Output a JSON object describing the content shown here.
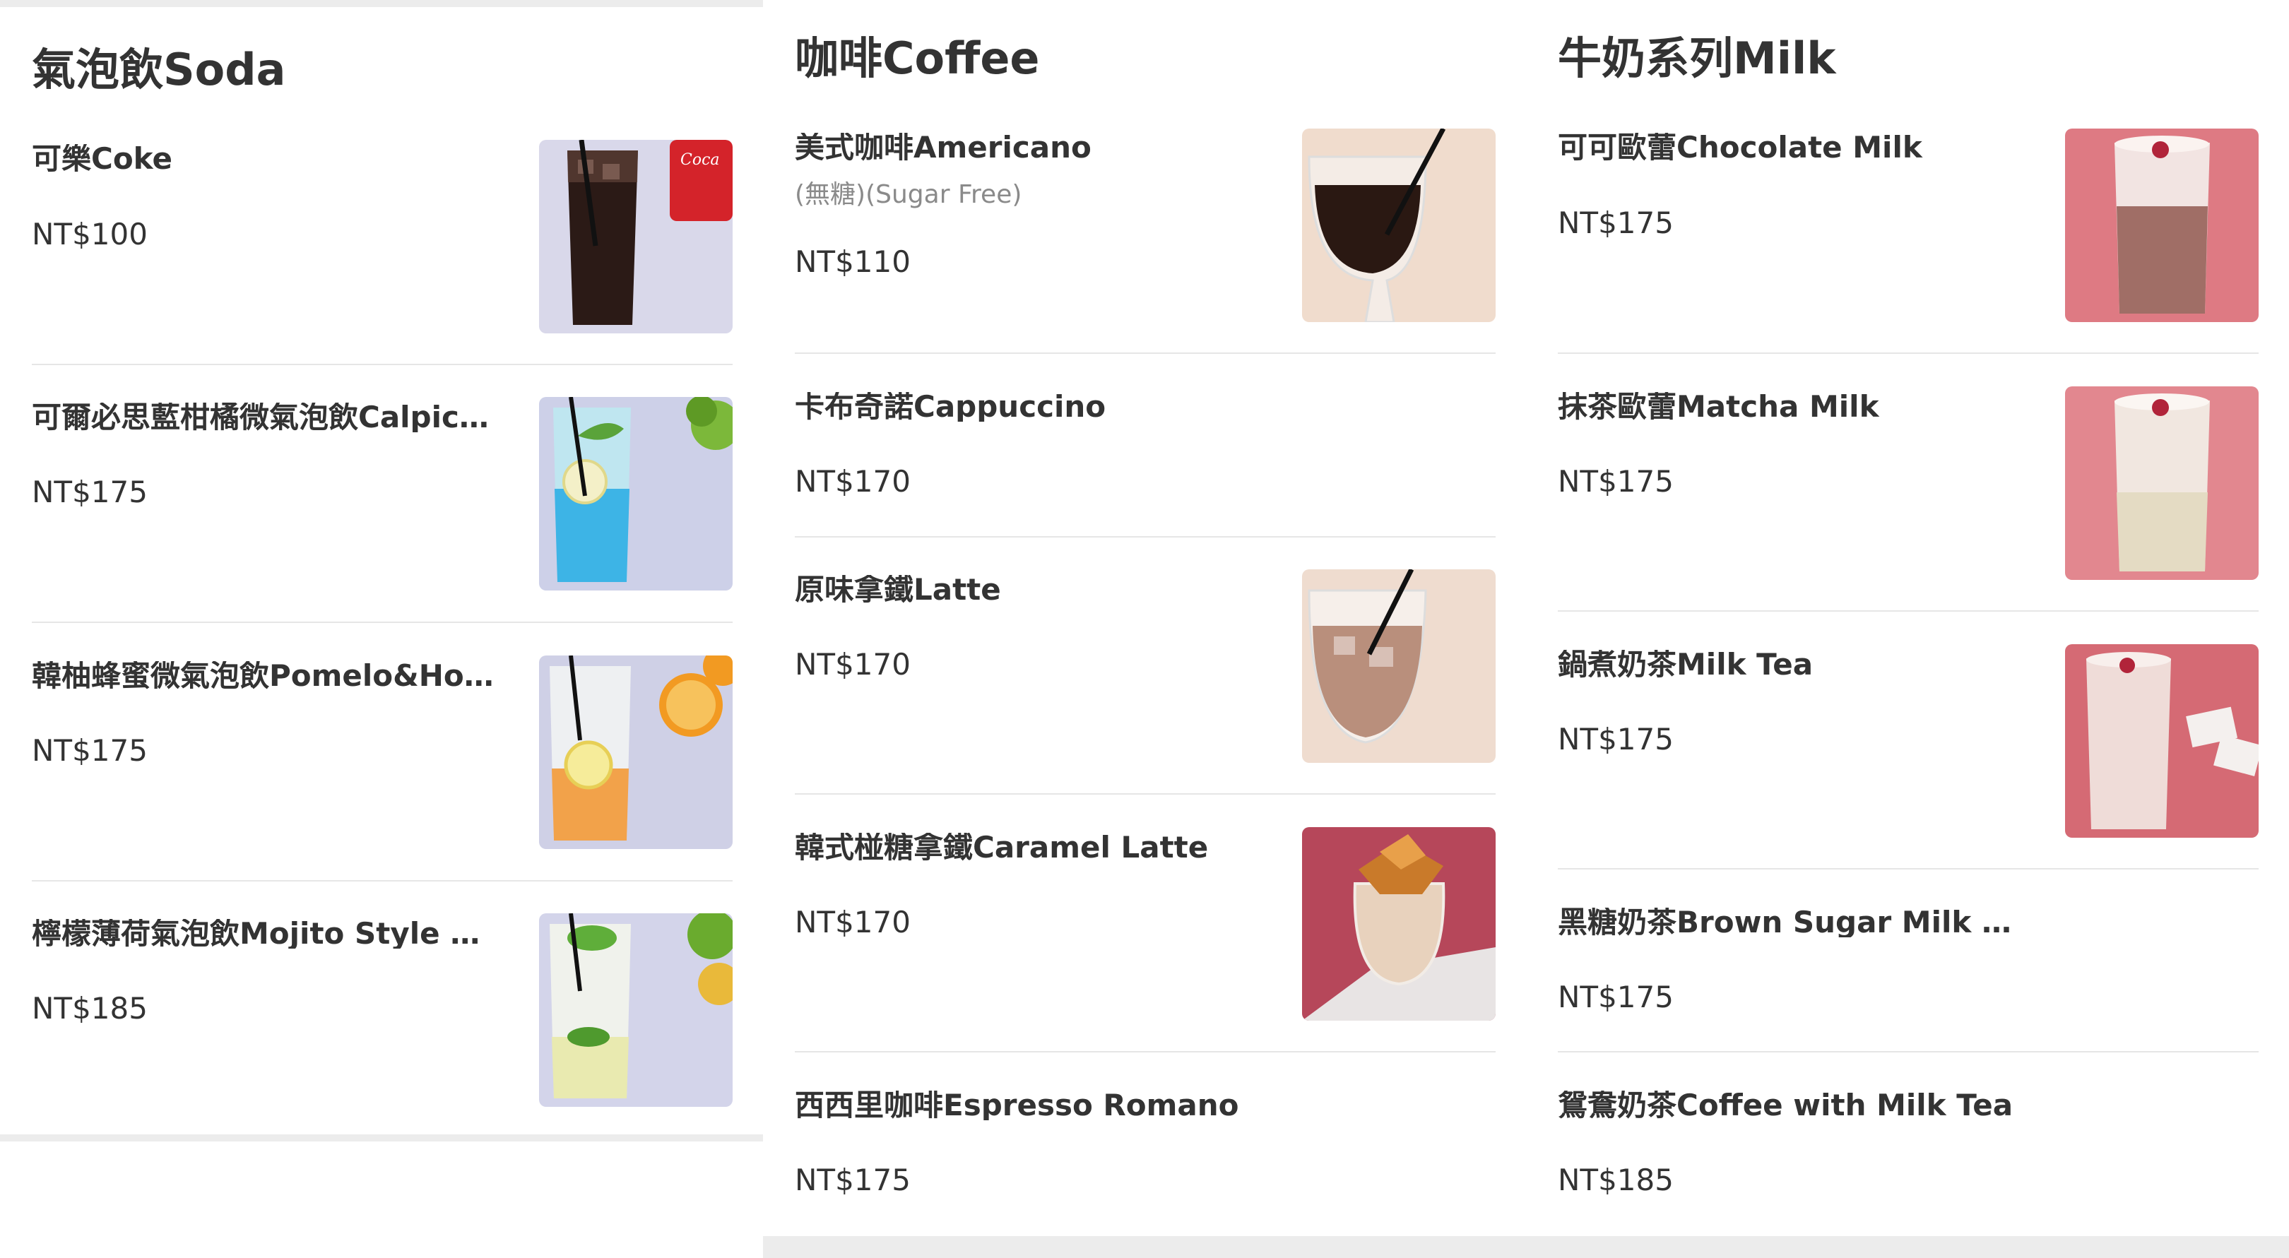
{
  "sections": {
    "soda": {
      "title": "氣泡飲Soda",
      "items": [
        {
          "name": "可樂Coke",
          "price": "NT$100",
          "image": "coke-glass-photo"
        },
        {
          "name": "可爾必思藍柑橘微氣泡飲Calpico...",
          "price": "NT$175",
          "image": "blue-calpico-soda-photo"
        },
        {
          "name": "韓柚蜂蜜微氣泡飲Pomelo&Hone...",
          "price": "NT$175",
          "image": "pomelo-honey-soda-photo"
        },
        {
          "name": "檸檬薄荷氣泡飲Mojito Style Soda",
          "price": "NT$185",
          "image": "mojito-soda-photo"
        }
      ]
    },
    "coffee": {
      "title": "咖啡Coffee",
      "items": [
        {
          "name": "美式咖啡Americano",
          "desc": "(無糖)(Sugar Free)",
          "price": "NT$110",
          "image": "americano-photo"
        },
        {
          "name": "卡布奇諾Cappuccino",
          "price": "NT$170"
        },
        {
          "name": "原味拿鐵Latte",
          "price": "NT$170",
          "image": "iced-latte-photo"
        },
        {
          "name": "韓式椪糖拿鐵Caramel Latte",
          "price": "NT$170",
          "image": "caramel-latte-photo"
        },
        {
          "name": "西西里咖啡Espresso Romano",
          "price": "NT$175"
        }
      ]
    },
    "milk": {
      "title": "牛奶系列Milk",
      "items": [
        {
          "name": "可可歐蕾Chocolate Milk",
          "price": "NT$175",
          "image": "chocolate-milk-photo"
        },
        {
          "name": "抹茶歐蕾Matcha Milk",
          "price": "NT$175",
          "image": "matcha-milk-photo"
        },
        {
          "name": "鍋煮奶茶Milk Tea",
          "price": "NT$175",
          "image": "milk-tea-photo"
        },
        {
          "name": "黑糖奶茶Brown Sugar Milk Tea",
          "price": "NT$175"
        },
        {
          "name": "鴛鴦奶茶Coffee with Milk Tea",
          "price": "NT$185"
        }
      ]
    }
  },
  "colors": {
    "text": "#333333",
    "muted": "#8a8a8a",
    "divider": "#e6e6e6",
    "bar": "#ececec",
    "lavender_bg": "#d6d6e9",
    "peach_bg": "#f0d9cc",
    "pink_bg": "#d9727c"
  }
}
